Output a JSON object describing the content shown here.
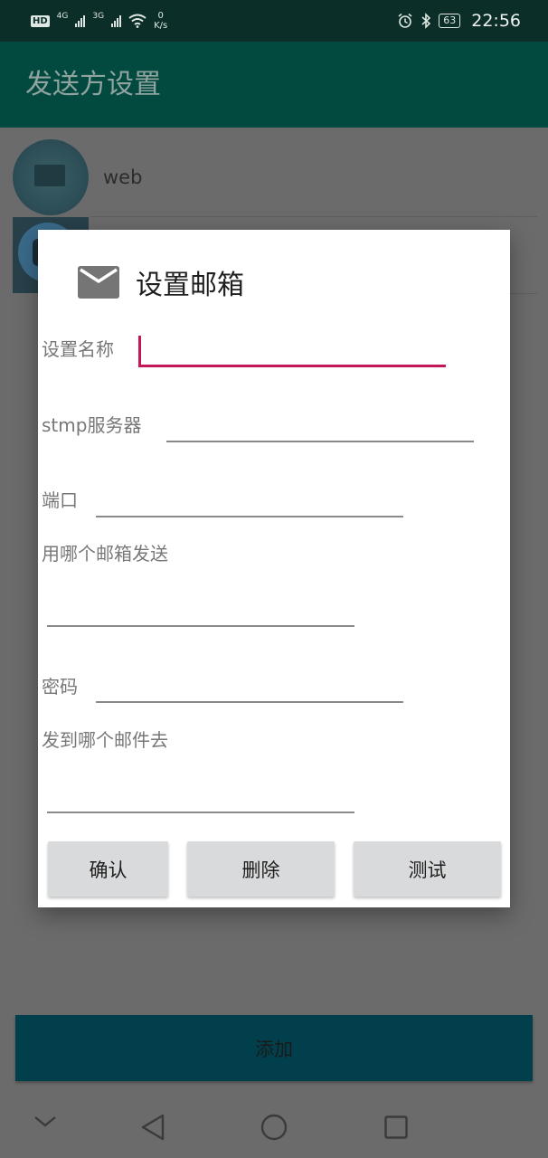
{
  "status_bar": {
    "hd": "HD",
    "net1": "4G",
    "net2": "3G",
    "speed_value": "0",
    "speed_unit": "K/s",
    "battery": "63",
    "time": "22:56"
  },
  "app_bar": {
    "title": "发送方设置"
  },
  "list": {
    "items": [
      {
        "label": "web"
      }
    ]
  },
  "dialog": {
    "title": "设置邮箱",
    "fields": {
      "name_label": "设置名称",
      "smtp_label": "stmp服务器",
      "port_label": "端口",
      "from_label": "用哪个邮箱发送",
      "password_label": "密码",
      "to_label": "发到哪个邮件去"
    },
    "buttons": {
      "confirm": "确认",
      "delete": "删除",
      "test": "测试"
    }
  },
  "add_button": {
    "label": "添加"
  },
  "colors": {
    "accent": "#c2185b",
    "appbar": "#024a3f",
    "statusbar": "#0b2f28",
    "add_button": "#013f4d",
    "scrim": "#6b6b6b"
  },
  "icons": {
    "dialog": "mail-icon",
    "nav": [
      "chevron-down-icon",
      "back-icon",
      "home-icon",
      "recents-icon"
    ]
  }
}
